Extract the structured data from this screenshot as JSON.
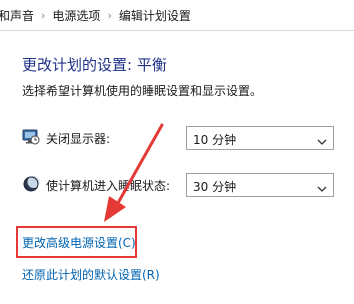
{
  "breadcrumb": {
    "items": [
      "和声音",
      "电源选项",
      "编辑计划设置"
    ],
    "separator": "›"
  },
  "page": {
    "title": "更改计划的设置: 平衡",
    "subtitle": "选择希望计算机使用的睡眠设置和显示设置。"
  },
  "settings": [
    {
      "label": "关闭显示器:",
      "value": "10 分钟",
      "icon": "monitor-icon"
    },
    {
      "label": "使计算机进入睡眠状态:",
      "value": "30 分钟",
      "icon": "moon-icon"
    }
  ],
  "links": {
    "advanced": "更改高级电源设置(C)",
    "restore": "还原此计划的默认设置(R)"
  },
  "colors": {
    "title": "#1e3287",
    "link": "#0063b1",
    "annotation": "#e53935"
  }
}
